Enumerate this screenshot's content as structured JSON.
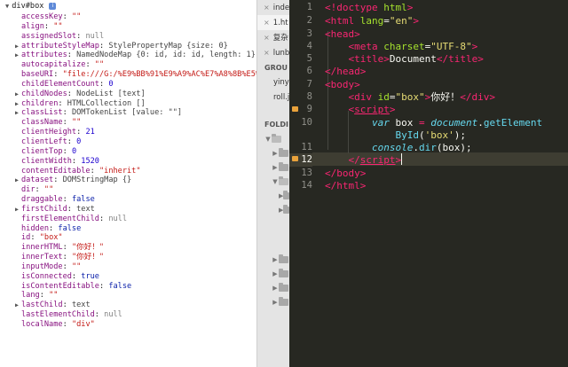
{
  "devtools": {
    "header": "div#box",
    "info_badge": "i",
    "rows": [
      {
        "expandable": false,
        "key": "accessKey",
        "value": "\"\"",
        "type": "str"
      },
      {
        "expandable": false,
        "key": "align",
        "value": "\"\"",
        "type": "str"
      },
      {
        "expandable": false,
        "key": "assignedSlot",
        "value": "null",
        "type": "null"
      },
      {
        "expandable": true,
        "key": "attributeStyleMap",
        "value": "StylePropertyMap {size: 0}",
        "type": "obj"
      },
      {
        "expandable": true,
        "key": "attributes",
        "value": "NamedNodeMap {0: id, id: id, length: 1}",
        "type": "obj"
      },
      {
        "expandable": false,
        "key": "autocapitalize",
        "value": "\"\"",
        "type": "str"
      },
      {
        "expandable": false,
        "key": "baseURI",
        "value": "\"file:///G:/%E9%BB%91%E9%A9%AC%E7%A8%8B%E5%",
        "type": "str"
      },
      {
        "expandable": false,
        "key": "childElementCount",
        "value": "0",
        "type": "num"
      },
      {
        "expandable": true,
        "key": "childNodes",
        "value": "NodeList [text]",
        "type": "obj"
      },
      {
        "expandable": true,
        "key": "children",
        "value": "HTMLCollection []",
        "type": "obj"
      },
      {
        "expandable": true,
        "key": "classList",
        "value": "DOMTokenList [value: \"\"]",
        "type": "obj"
      },
      {
        "expandable": false,
        "key": "className",
        "value": "\"\"",
        "type": "str"
      },
      {
        "expandable": false,
        "key": "clientHeight",
        "value": "21",
        "type": "num"
      },
      {
        "expandable": false,
        "key": "clientLeft",
        "value": "0",
        "type": "num"
      },
      {
        "expandable": false,
        "key": "clientTop",
        "value": "0",
        "type": "num"
      },
      {
        "expandable": false,
        "key": "clientWidth",
        "value": "1520",
        "type": "num"
      },
      {
        "expandable": false,
        "key": "contentEditable",
        "value": "\"inherit\"",
        "type": "str"
      },
      {
        "expandable": true,
        "key": "dataset",
        "value": "DOMStringMap {}",
        "type": "obj"
      },
      {
        "expandable": false,
        "key": "dir",
        "value": "\"\"",
        "type": "str"
      },
      {
        "expandable": false,
        "key": "draggable",
        "value": "false",
        "type": "bool"
      },
      {
        "expandable": true,
        "key": "firstChild",
        "value": "text",
        "type": "obj"
      },
      {
        "expandable": false,
        "key": "firstElementChild",
        "value": "null",
        "type": "null"
      },
      {
        "expandable": false,
        "key": "hidden",
        "value": "false",
        "type": "bool"
      },
      {
        "expandable": false,
        "key": "id",
        "value": "\"box\"",
        "type": "str"
      },
      {
        "expandable": false,
        "key": "innerHTML",
        "value": "\"你好！\"",
        "type": "str"
      },
      {
        "expandable": false,
        "key": "innerText",
        "value": "\"你好！\"",
        "type": "str"
      },
      {
        "expandable": false,
        "key": "inputMode",
        "value": "\"\"",
        "type": "str"
      },
      {
        "expandable": false,
        "key": "isConnected",
        "value": "true",
        "type": "bool"
      },
      {
        "expandable": false,
        "key": "isContentEditable",
        "value": "false",
        "type": "bool"
      },
      {
        "expandable": false,
        "key": "lang",
        "value": "\"\"",
        "type": "str"
      },
      {
        "expandable": true,
        "key": "lastChild",
        "value": "text",
        "type": "obj"
      },
      {
        "expandable": false,
        "key": "lastElementChild",
        "value": "null",
        "type": "null"
      },
      {
        "expandable": false,
        "key": "localName",
        "value": "\"div\"",
        "type": "str"
      }
    ]
  },
  "sidebar": {
    "tabs": [
      {
        "label": "inde",
        "active": false
      },
      {
        "label": "1.ht",
        "active": true
      },
      {
        "label": "复杂",
        "active": false
      },
      {
        "label": "lunb",
        "active": false
      }
    ],
    "group_heading": "GROU",
    "group_files": [
      "yiny",
      "roll.j"
    ],
    "folders_heading": "FOLDI"
  },
  "editor": {
    "line_numbers": [
      "1",
      "2",
      "3",
      "4",
      "5",
      "6",
      "7",
      "8",
      "9",
      "10",
      "",
      "11",
      "12",
      "13",
      "14"
    ],
    "current_line": "12"
  }
}
